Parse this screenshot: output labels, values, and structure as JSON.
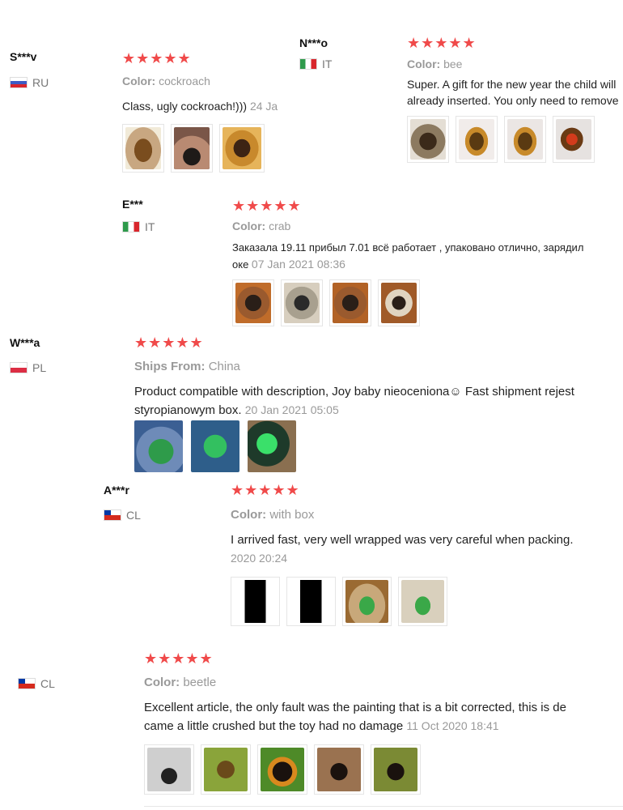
{
  "labels": {
    "color": "Color:",
    "ships_from": "Ships From:"
  },
  "reviews": [
    {
      "user": "S***v",
      "country": "RU",
      "stars": "★★★★★",
      "attr_value": "cockroach",
      "text": "Class, ugly cockroach!)))",
      "date": "24 Ja"
    },
    {
      "user": "N***o",
      "country": "IT",
      "stars": "★★★★★",
      "attr_value": "bee",
      "text1": "Super. A gift for the new year the child will",
      "text2": "already inserted. You only need to remove"
    },
    {
      "user": "E***",
      "country": "IT",
      "stars": "★★★★★",
      "attr_value": "crab",
      "text1": "Заказала 19.11 прибыл 7.01 всё работает , упаковано отлично, зарядил",
      "text2": "оке",
      "date": "07 Jan 2021 08:36"
    },
    {
      "user": "W***a",
      "country": "PL",
      "stars": "★★★★★",
      "attr_value": "China",
      "text1": "Product compatible with description, Joy baby nieoceniona☺ Fast shipment rejest",
      "text2": "styropianowym box.",
      "date": "20 Jan 2021 05:05"
    },
    {
      "user": "A***r",
      "country": "CL",
      "stars": "★★★★★",
      "attr_value": "with box",
      "text1": "I arrived fast, very well wrapped was very careful when packing.",
      "date": "2020 20:24"
    },
    {
      "user": "",
      "country": "CL",
      "stars": "★★★★★",
      "attr_value": "beetle",
      "text1": "Excellent article, the only fault was the painting that is a bit corrected, this is de",
      "text2": "came a little crushed but the toy had no damage",
      "date": "11 Oct 2020 18:41"
    }
  ],
  "colors": {
    "star": "#f04a4a",
    "muted": "#999999",
    "text": "#222222"
  }
}
